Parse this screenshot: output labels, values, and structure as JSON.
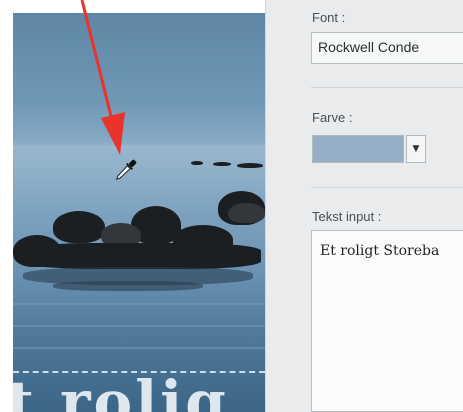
{
  "panel": {
    "font_label": "Font :",
    "font_value": "Rockwell Conde",
    "color_label": "Farve :",
    "color_value": "#97aec7",
    "text_input_label": "Tekst input :",
    "text_input_value": "Et roligt Storeba"
  },
  "photo": {
    "overlay_text": "t rolig"
  },
  "icons": {
    "eyedropper": "eyedropper-icon",
    "arrow": "red-arrow",
    "dropdown": "chevron-down-icon"
  },
  "colors": {
    "arrow": "#e8342c",
    "sky": "#5f87a5",
    "sea": "#4f7a9c"
  }
}
